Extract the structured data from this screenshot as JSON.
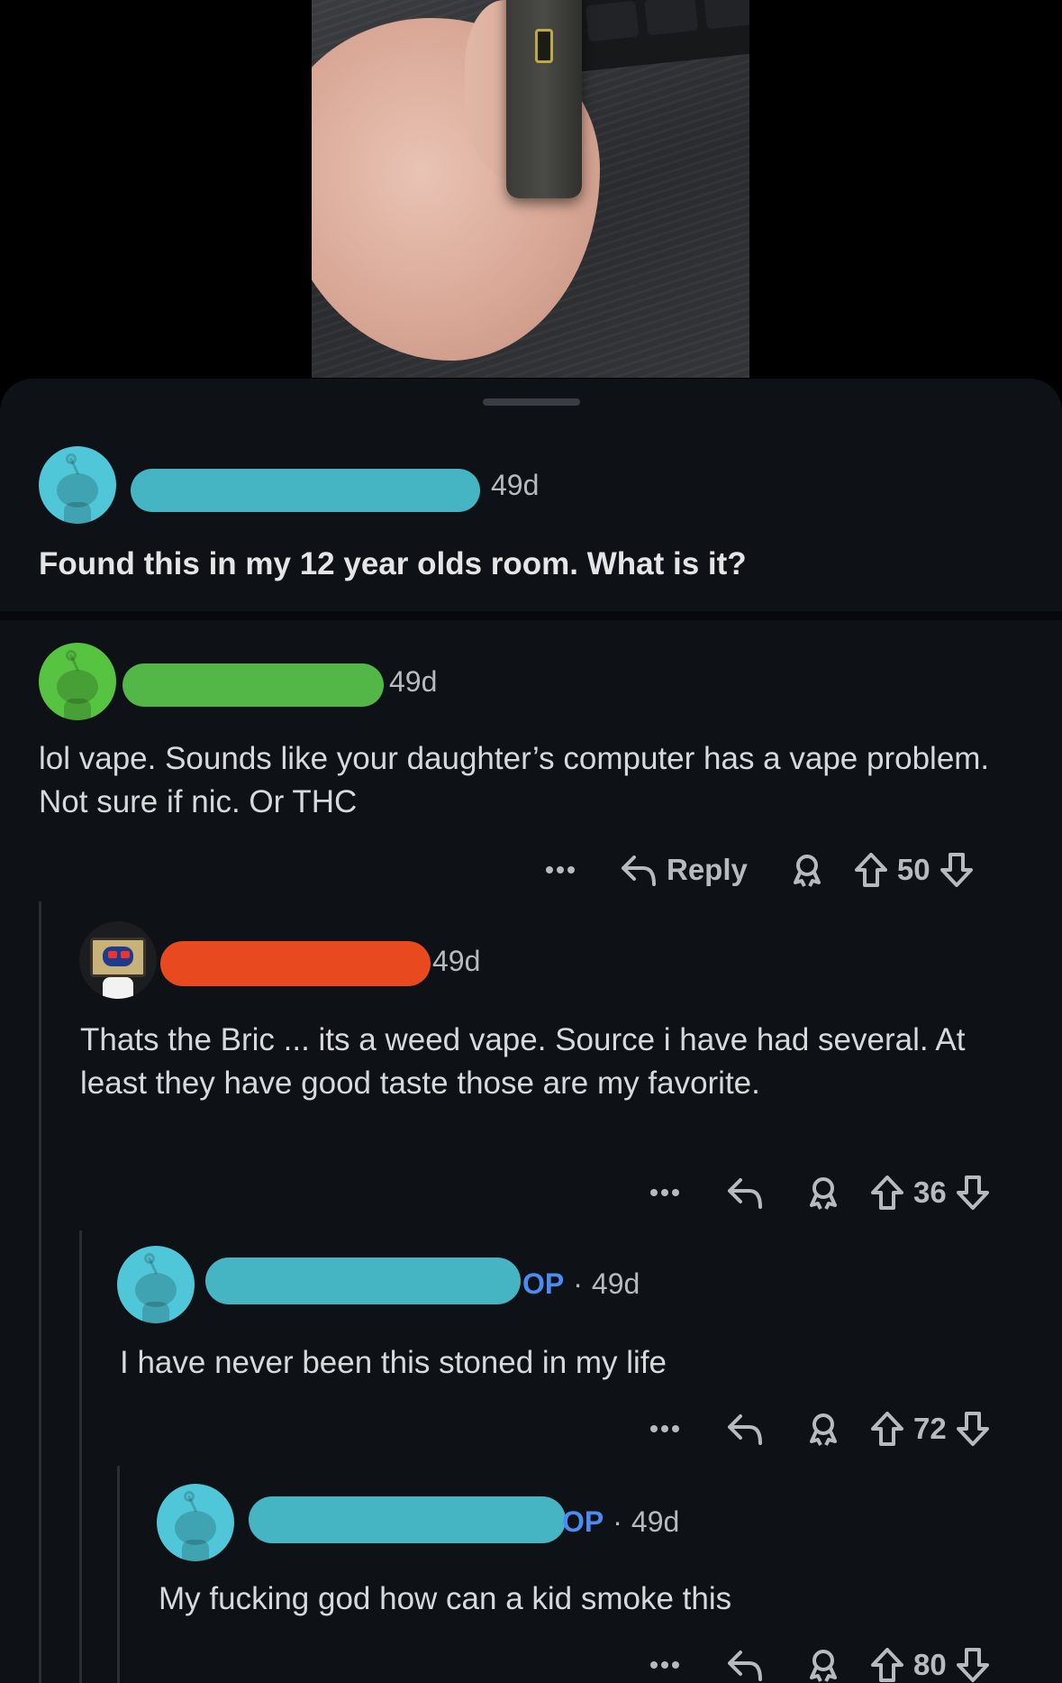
{
  "post": {
    "age": "49d",
    "title": "Found this in my 12 year olds room. What is it?",
    "avatar_color": "#4fc7d8",
    "redact_color": "#45b5c4"
  },
  "comments": [
    {
      "age": "49d",
      "op": false,
      "text": "lol vape. Sounds like your daughter’s computer has a vape problem. Not sure if nic. Or THC",
      "reply_label": "Reply",
      "score": "50",
      "avatar_color": "#56c441",
      "redact_color": "#52b746"
    },
    {
      "age": "49d",
      "op": false,
      "text": "Thats the Bric ... its a weed vape.  Source i have had several.   At least they have good taste those are my favorite.",
      "score": "36",
      "redact_color": "#e8491f"
    },
    {
      "age": "49d",
      "op": true,
      "op_label": "OP",
      "dot": "·",
      "text": "I have never been this stoned in my life",
      "score": "72",
      "avatar_color": "#4fc7d8",
      "redact_color": "#45b5c4"
    },
    {
      "age": "49d",
      "op": true,
      "op_label": "OP",
      "dot": "·",
      "text": "My fucking god how can a kid smoke this",
      "score": "80",
      "avatar_color": "#4fc7d8",
      "redact_color": "#45b5c4"
    }
  ],
  "icons": {
    "more": "more-options-icon",
    "reply": "reply-arrow-icon",
    "award": "award-icon",
    "upvote": "upvote-arrow-icon",
    "downvote": "downvote-arrow-icon"
  }
}
